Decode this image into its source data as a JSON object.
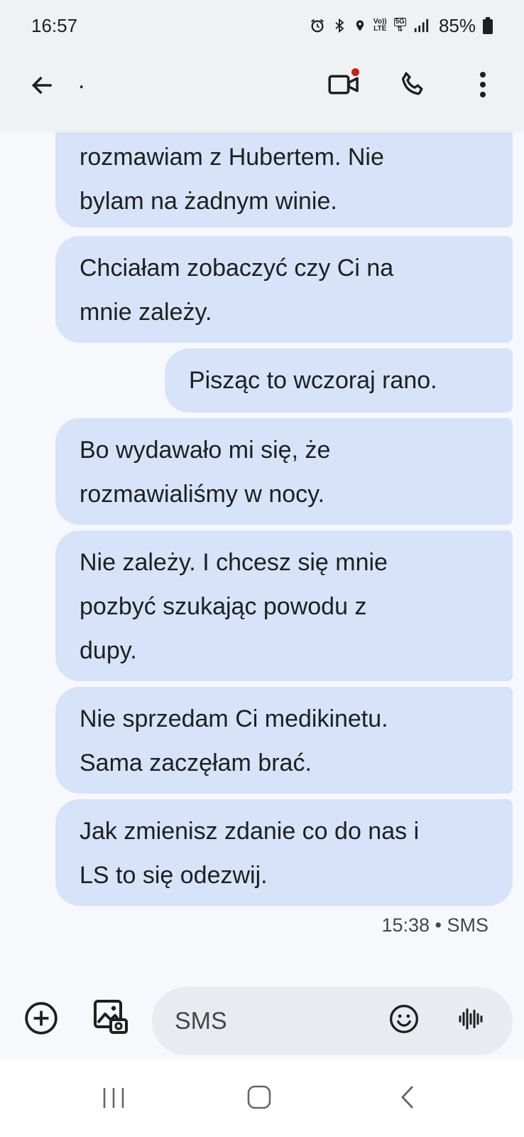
{
  "status_bar": {
    "time": "16:57",
    "battery": "85%",
    "network_top": "Vo))",
    "network_bottom": "LTE",
    "fiveg": "5G",
    "icons": [
      "alarm-icon",
      "bluetooth-icon",
      "location-icon",
      "volte-icon",
      "5g-icon",
      "signal-icon",
      "battery-icon"
    ]
  },
  "app_bar": {
    "title": ".",
    "icons": [
      "back-arrow-icon",
      "video-call-icon",
      "phone-icon",
      "more-vert-icon"
    ],
    "video_badge_color": "#c5221f"
  },
  "messages": [
    {
      "text": "rozmawiam z Hubertem. Nie\nbylam na żadnym winie."
    },
    {
      "text": "Chciałam zobaczyć czy Ci na\nmnie zależy."
    },
    {
      "text": "Pisząc to wczoraj rano."
    },
    {
      "text": "Bo wydawało mi się, że\nrozmawialiśmy w nocy."
    },
    {
      "text": "Nie zależy. I chcesz się mnie\npozbyć szukając powodu z\ndupy."
    },
    {
      "text": "Nie sprzedam Ci medikinetu.\nSama zaczęłam brać."
    },
    {
      "text": "Jak zmienisz zdanie co do nas i\nLS to się odezwij."
    }
  ],
  "last_message_meta": "15:38 • SMS",
  "composer": {
    "placeholder": "SMS",
    "icons": [
      "add-circle-icon",
      "gallery-icon",
      "emoji-icon",
      "voice-waveform-icon"
    ]
  },
  "nav_bar": {
    "icons": [
      "recents-icon",
      "home-icon",
      "back-icon"
    ]
  },
  "colors": {
    "bubble": "#d6e3f8",
    "app_bar": "#f0f1f3",
    "background": "#f7f8fc",
    "input_pill": "#e8ebf1"
  }
}
